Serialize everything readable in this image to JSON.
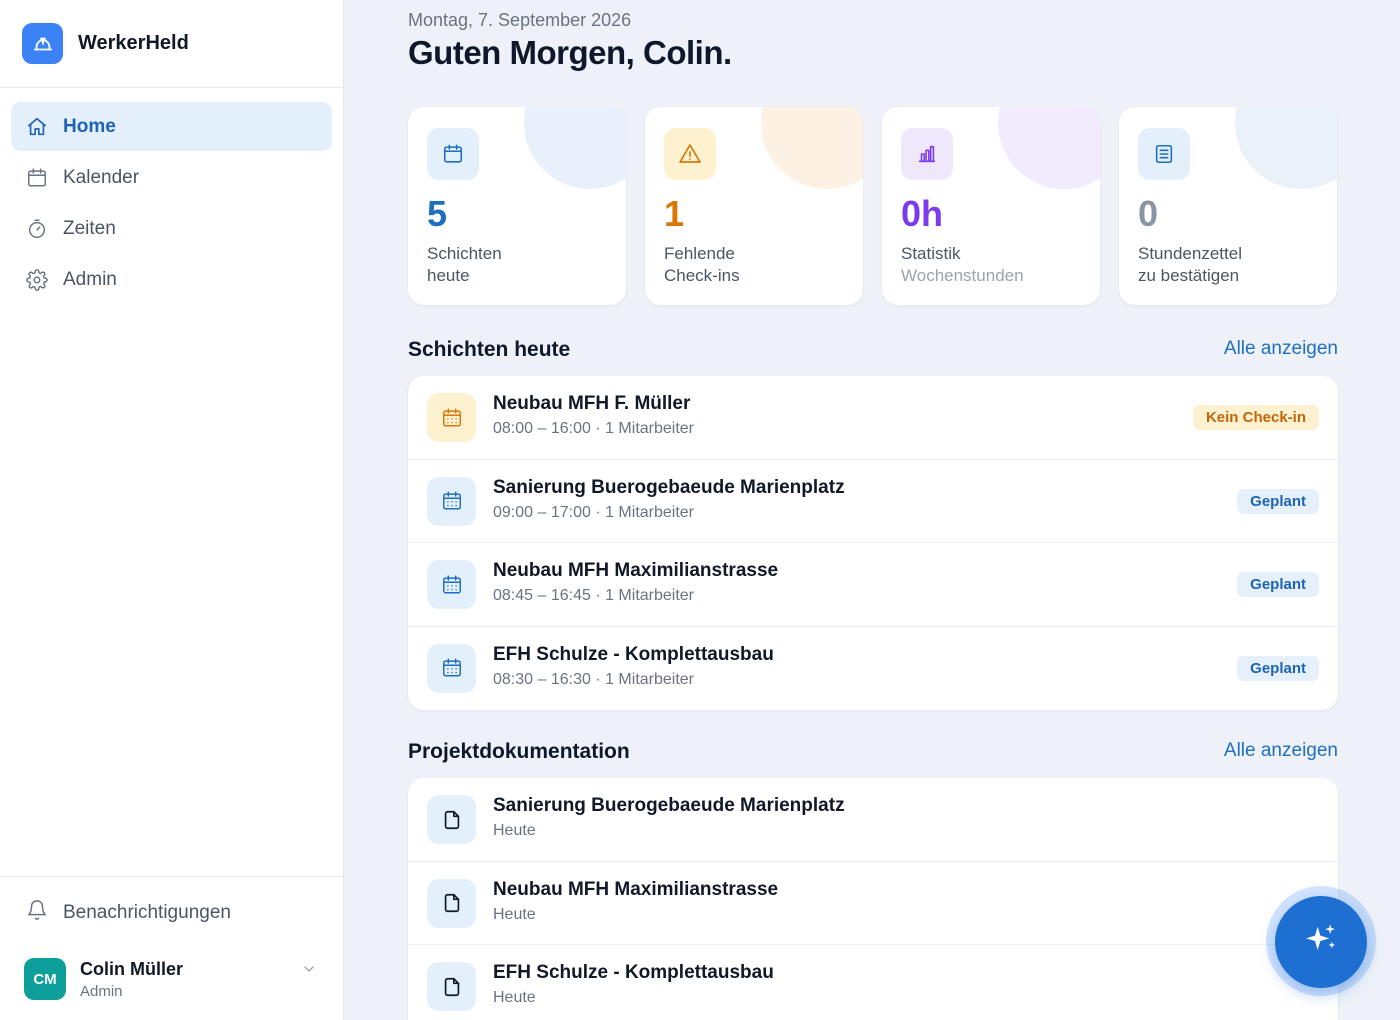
{
  "app": {
    "name": "WerkerHeld",
    "logo_icon": "hardhat-icon"
  },
  "nav": {
    "items": [
      {
        "label": "Home",
        "icon": "home-icon",
        "active": true
      },
      {
        "label": "Kalender",
        "icon": "calendar-icon",
        "active": false
      },
      {
        "label": "Zeiten",
        "icon": "stopwatch-icon",
        "active": false
      },
      {
        "label": "Admin",
        "icon": "gear-icon",
        "active": false
      }
    ]
  },
  "notifications": {
    "label": "Benachrichtigungen",
    "icon": "bell-icon"
  },
  "user": {
    "initials": "CM",
    "name": "Colin Müller",
    "role": "Admin"
  },
  "header": {
    "date": "Montag, 7. September 2026",
    "greeting": "Guten Morgen, Colin."
  },
  "stats": [
    {
      "value": "5",
      "label1": "Schichten",
      "label2": "heute",
      "icon": "calendar-icon",
      "color": "#1e6fc0"
    },
    {
      "value": "1",
      "label1": "Fehlende",
      "label2": "Check-ins",
      "icon": "warning-icon",
      "color": "#d97706"
    },
    {
      "value": "0h",
      "label1": "Statistik",
      "label2": "Wochenstunden",
      "icon": "bar-chart-icon",
      "color": "#7c3aed"
    },
    {
      "value": "0",
      "label1": "Stundenzettel",
      "label2": "zu bestätigen",
      "icon": "document-icon",
      "color": "#8895a7"
    }
  ],
  "shifts": {
    "title": "Schichten heute",
    "link": "Alle anzeigen",
    "items": [
      {
        "title": "Neubau MFH F. Müller",
        "subtitle": "08:00 – 16:00 · 1 Mitarbeiter",
        "badge": "Kein Check-in",
        "status": "warn"
      },
      {
        "title": "Sanierung Buerogebaeude Marienplatz",
        "subtitle": "09:00 – 17:00 · 1 Mitarbeiter",
        "badge": "Geplant",
        "status": "plan"
      },
      {
        "title": "Neubau MFH Maximilianstrasse",
        "subtitle": "08:45 – 16:45 · 1 Mitarbeiter",
        "badge": "Geplant",
        "status": "plan"
      },
      {
        "title": "EFH Schulze - Komplettausbau",
        "subtitle": "08:30 – 16:30 · 1 Mitarbeiter",
        "badge": "Geplant",
        "status": "plan"
      }
    ]
  },
  "docs": {
    "title": "Projektdokumentation",
    "link": "Alle anzeigen",
    "items": [
      {
        "title": "Sanierung Buerogebaeude Marienplatz",
        "subtitle": "Heute"
      },
      {
        "title": "Neubau MFH Maximilianstrasse",
        "subtitle": "Heute"
      },
      {
        "title": "EFH Schulze - Komplettausbau",
        "subtitle": "Heute"
      }
    ]
  },
  "fab": {
    "icon": "sparkle-icon"
  }
}
